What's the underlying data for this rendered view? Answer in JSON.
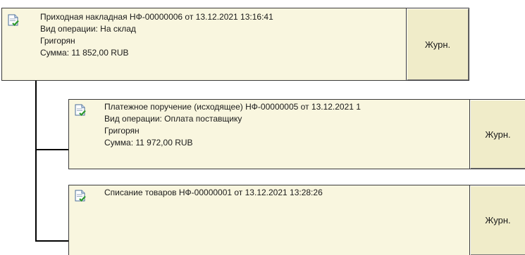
{
  "documents": [
    {
      "title": "Приходная накладная НФ-00000006 от 13.12.2021 13:16:41",
      "operation": "Вид операции: На склад",
      "person": "Григорян",
      "amount": "Сумма: 11 852,00 RUB",
      "journal_label": "Журн."
    },
    {
      "title": "Платежное поручение (исходящее) НФ-00000005 от 13.12.2021 1",
      "operation": "Вид операции: Оплата поставщику",
      "person": "Григорян",
      "amount": "Сумма: 11 972,00 RUB",
      "journal_label": "Журн."
    },
    {
      "title": "Списание товаров НФ-00000001 от 13.12.2021 13:28:26",
      "journal_label": "Журн."
    }
  ],
  "colors": {
    "card_bg": "#f9f6df",
    "button_bg": "#f0ecc9",
    "border": "#3a3a3a",
    "connector": "#000000"
  },
  "icons": [
    "document-posted-icon"
  ]
}
